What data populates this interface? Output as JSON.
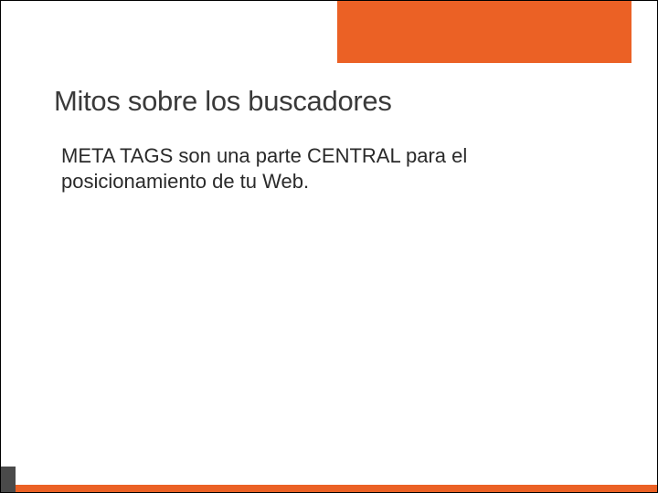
{
  "slide": {
    "title": "Mitos sobre los buscadores",
    "body": "META TAGS son una parte CENTRAL para el posicionamiento de tu Web."
  }
}
